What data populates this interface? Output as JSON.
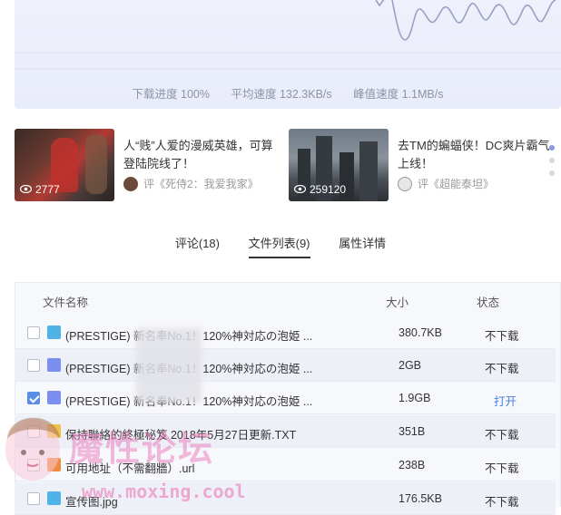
{
  "speed": {
    "progress_label": "下载进度 100%",
    "avg_label": "平均速度 132.3KB/s",
    "peak_label": "峰值速度 1.1MB/s"
  },
  "cards": [
    {
      "views": "2777",
      "title": "人“贱”人爱的漫威英雄，可算登陆院线了！",
      "meta": "评《死侍2：我爱我家》"
    },
    {
      "views": "259120",
      "title": "去TM的蝙蝠侠！DC爽片霸气上线！",
      "meta": "评《超能泰坦》"
    }
  ],
  "tabs": [
    {
      "label": "评论(18)"
    },
    {
      "label": "文件列表(9)"
    },
    {
      "label": "属性详情"
    }
  ],
  "table": {
    "headers": {
      "name": "文件名称",
      "size": "大小",
      "state": "状态"
    },
    "rows": [
      {
        "name": "(PRESTIGE)     新名奉No.1！120%神対応の泡姫 ...",
        "size": "380.7KB",
        "state": "不下载",
        "icon": "image-icon"
      },
      {
        "name": "(PRESTIGE)     新名奉No.1！120%神対応の泡姫 ...",
        "size": "2GB",
        "state": "不下载",
        "icon": "video-icon"
      },
      {
        "name": "(PRESTIGE)     新名奉No.1！120%神対応の泡姫 ...",
        "size": "1.9GB",
        "state": "打开",
        "icon": "video-icon"
      },
      {
        "name": "保持聯絡的終極秘笈 2018年5月27日更新.TXT",
        "size": "351B",
        "state": "不下载",
        "icon": "text-icon"
      },
      {
        "name": "可用地址（不需翻牆）.url",
        "size": "238B",
        "state": "不下载",
        "icon": "link-icon"
      },
      {
        "name": "宣传图.jpg",
        "size": "176.5KB",
        "state": "不下载",
        "icon": "image-icon"
      }
    ]
  },
  "watermark": {
    "title": "魔性论坛",
    "url": "www.moxing.cool"
  },
  "colors": {
    "accent": "#4a7fe0",
    "checked": "#5b8de8",
    "panel": "#eef0fb"
  }
}
